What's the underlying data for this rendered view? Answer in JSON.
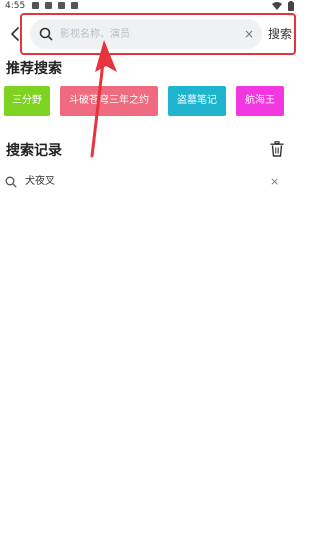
{
  "status_bar": {
    "time": "4:55"
  },
  "search": {
    "placeholder": "影视名称、演员",
    "value": "",
    "clear_symbol": "×",
    "submit_label": "搜索"
  },
  "hot_search": {
    "title": "推荐搜索",
    "tags": [
      {
        "label": "三分野",
        "color": "#7ed321"
      },
      {
        "label": "斗破苍穹三年之约",
        "color": "#f06b7f"
      },
      {
        "label": "盗墓笔记",
        "color": "#1fb5cf"
      },
      {
        "label": "航海王",
        "color": "#f236e0"
      }
    ]
  },
  "history": {
    "title": "搜索记录",
    "items": [
      {
        "label": "犬夜叉",
        "delete_symbol": "×"
      }
    ]
  },
  "icons": {
    "back": "back-arrow-icon",
    "search": "search-icon",
    "clear": "clear-icon",
    "trash": "trash-icon",
    "history_search": "search-icon"
  },
  "annotation_color": "#e8323c"
}
